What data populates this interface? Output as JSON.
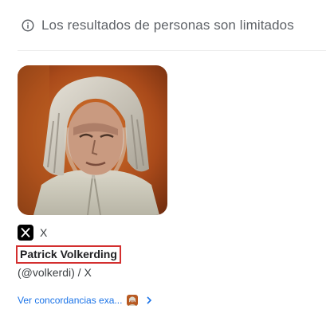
{
  "notice": {
    "icon": "info-icon",
    "text": "Los resultados de personas son limitados"
  },
  "result_card": {
    "photo_alt": "Patrick Volkerding",
    "source": {
      "icon": "x-logo-icon",
      "name": "X"
    },
    "name": "Patrick Volkerding",
    "handle": "(@volkerdi) / X",
    "exact_matches_link": "Ver concordancias exa...",
    "chevron_icon": "chevron-right-icon",
    "highlight_color": "#d32f2f",
    "link_color": "#1a73e8"
  }
}
